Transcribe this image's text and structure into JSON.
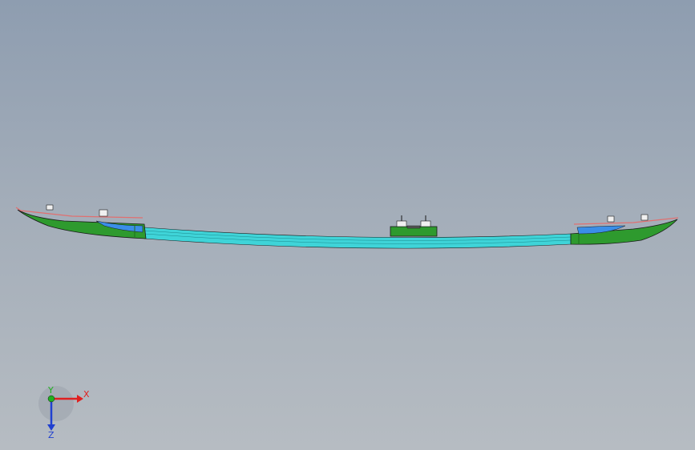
{
  "viewport": {
    "background_top": "#8e9db0",
    "background_bottom": "#b6bcc2"
  },
  "model": {
    "colors": {
      "green": "#2e9a2e",
      "dark_green": "#1f6e1f",
      "cyan": "#3fd4d8",
      "blue": "#3a8ee8",
      "edge": "#1a1a1a",
      "accent": "#e07070"
    }
  },
  "triad": {
    "x_label": "X",
    "y_label": "Y",
    "z_label": "Z",
    "x_color": "#e02020",
    "y_color": "#20b020",
    "z_color": "#2040d0"
  }
}
